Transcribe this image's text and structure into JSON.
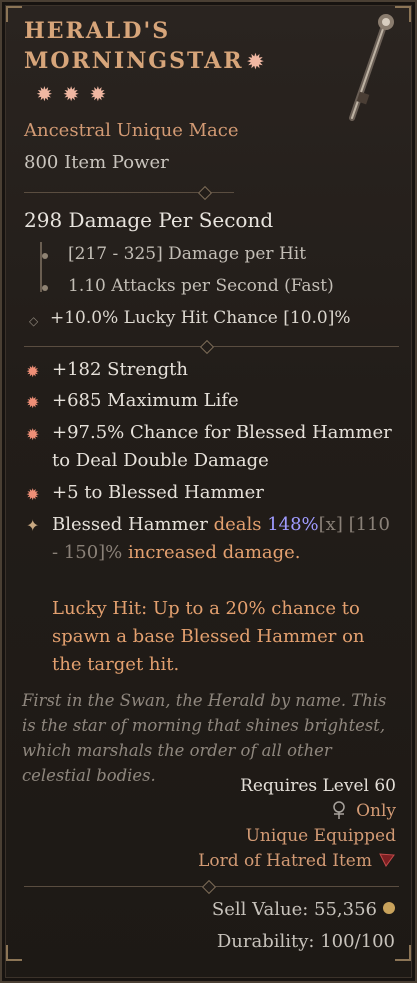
{
  "item": {
    "name_line1": "HERALD'S",
    "name_line2": "MORNINGSTAR",
    "rarity": "Ancestral Unique Mace",
    "item_power": "800 Item Power"
  },
  "stats": {
    "dps": "298 Damage Per Second",
    "damage_per_hit": "[217 - 325] Damage per Hit",
    "attacks_per_second": "1.10 Attacks per Second (Fast)",
    "lucky_hit_prefix": "+10.0% Lucky Hit Chance ",
    "lucky_hit_range": "[10.0]%"
  },
  "affixes": [
    "+182 Strength",
    "+685 Maximum Life",
    "+97.5% Chance for Blessed Hammer",
    "to Deal Double Damage",
    "+5 to Blessed Hammer"
  ],
  "legendary": {
    "line1_a": "Blessed Hammer ",
    "line1_b": "deals ",
    "line1_value": "148%",
    "line1_x": "[x]",
    "line1_range_start": " [110",
    "line2_range_end": "- 150]%",
    "line2_rest": " increased damage.",
    "lucky_hit_line1": "Lucky Hit: Up to a 20% chance to",
    "lucky_hit_line2": "spawn a base Blessed Hammer on",
    "lucky_hit_line3": "the target hit."
  },
  "flavor_text": "First in the Swan, the Herald by name. This is the star of morning that shines brightest, which marshals the order of all other celestial bodies.",
  "requirements": {
    "level": "Requires Level 60",
    "class_only": "Only",
    "unique_equipped": "Unique Equipped",
    "lord_of_hatred": "Lord of Hatred Item"
  },
  "footer": {
    "sell_value": "Sell Value: 55,356",
    "durability": "Durability: 100/100"
  },
  "colors": {
    "title": "#d7a57a",
    "affix_star": "#ef8f77",
    "legendary_text": "#e3a06f",
    "legendary_value": "#9f9bff"
  },
  "icons": {
    "gem": "gem-socket-icon",
    "weapon": "mace-icon",
    "class": "paladin-icon",
    "expansion": "lord-of-hatred-icon",
    "gold": "gold-coin-icon"
  }
}
